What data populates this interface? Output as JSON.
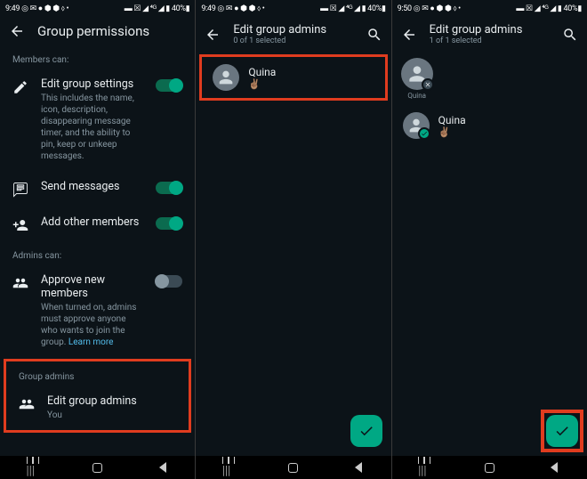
{
  "screen1": {
    "status": {
      "time": "9:49",
      "iconsL": "◎ ✉ ● ⬢ ⬢ ⬨ •",
      "iconsR": "▬ ☒ ◢ ⁴ᴳ ◢ ▮ 40%▮"
    },
    "title": "Group permissions",
    "membersCanLabel": "Members can:",
    "settings": {
      "editGroup": {
        "title": "Edit group settings",
        "sub": "This includes the name, icon, description, disappearing message timer, and the ability to pin, keep or unkeep messages."
      },
      "sendMessages": {
        "title": "Send messages"
      },
      "addMembers": {
        "title": "Add other members"
      }
    },
    "adminsCanLabel": "Admins can:",
    "approve": {
      "title": "Approve new members",
      "sub": "When turned on, admins must approve anyone who wants to join the group.",
      "link": "Learn more"
    },
    "groupAdminsLabel": "Group admins",
    "editAdmins": {
      "title": "Edit group admins",
      "sub": "You"
    }
  },
  "screen2": {
    "status": {
      "time": "9:49",
      "iconsL": "◎ ✉ ● ⬢ ⬢ ⬨ •",
      "iconsR": "▬ ☒ ◢ ⁴ᴳ ◢ ▮ 40%▮"
    },
    "title": "Edit group admins",
    "sub": "0 of 1 selected",
    "member": {
      "name": "Quina",
      "status": "✌🏽"
    }
  },
  "screen3": {
    "status": {
      "time": "9:50",
      "iconsL": "◎ ✉ ● ⬢ ⬢ ⬨ •",
      "iconsR": "▬ ☒ ◢ ⁴ᴳ ◢ ▮ 40%▮"
    },
    "title": "Edit group admins",
    "sub": "1 of 1 selected",
    "chipName": "Quina",
    "member": {
      "name": "Quina",
      "status": "✌🏽"
    }
  }
}
